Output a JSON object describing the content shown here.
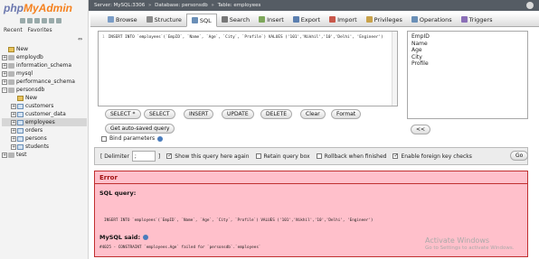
{
  "logo": {
    "part1": "php",
    "part2": "MyAdmin"
  },
  "nav": {
    "recent_label": "Recent",
    "favorites_label": "Favorites",
    "collapse_glyph": "⇔",
    "tree": [
      {
        "label": "New",
        "kind": "new",
        "level": 0
      },
      {
        "label": "employdb",
        "kind": "db",
        "level": 0
      },
      {
        "label": "information_schema",
        "kind": "db",
        "level": 0
      },
      {
        "label": "mysql",
        "kind": "db",
        "level": 0
      },
      {
        "label": "performance_schema",
        "kind": "db",
        "level": 0
      },
      {
        "label": "personsdb",
        "kind": "db",
        "level": 0,
        "expanded": true
      },
      {
        "label": "New",
        "kind": "new",
        "level": 1
      },
      {
        "label": "customers",
        "kind": "table",
        "level": 1
      },
      {
        "label": "customer_data",
        "kind": "table",
        "level": 1
      },
      {
        "label": "employees",
        "kind": "table",
        "level": 1,
        "selected": true
      },
      {
        "label": "orders",
        "kind": "table",
        "level": 1
      },
      {
        "label": "persons",
        "kind": "table",
        "level": 1
      },
      {
        "label": "students",
        "kind": "table",
        "level": 1
      },
      {
        "label": "test",
        "kind": "db",
        "level": 0
      }
    ]
  },
  "titlebar": {
    "server": "Server: MySQL:3306",
    "database": "Database: personsdb",
    "table": "Table: employees"
  },
  "tabs": [
    {
      "label": "Browse",
      "icon": "browse-icon",
      "color": "#7a9cc6"
    },
    {
      "label": "Structure",
      "icon": "structure-icon",
      "color": "#8a8a8a"
    },
    {
      "label": "SQL",
      "icon": "sql-icon",
      "color": "#6a8fb7",
      "active": true
    },
    {
      "label": "Search",
      "icon": "search-icon",
      "color": "#777"
    },
    {
      "label": "Insert",
      "icon": "insert-icon",
      "color": "#7da75a"
    },
    {
      "label": "Export",
      "icon": "export-icon",
      "color": "#5b7fb0"
    },
    {
      "label": "Import",
      "icon": "import-icon",
      "color": "#c9574a"
    },
    {
      "label": "Privileges",
      "icon": "privileges-icon",
      "color": "#c9a24a"
    },
    {
      "label": "Operations",
      "icon": "operations-icon",
      "color": "#6a8fb7"
    },
    {
      "label": "Triggers",
      "icon": "triggers-icon",
      "color": "#8b6fb7"
    }
  ],
  "sql": {
    "line_number": "1",
    "query": "INSERT INTO `employees`(`EmpID`, `Name`, `Age`, `City`, `Profile`) VALUES ('101','Nikhil','10','Delhi', 'Engineer')"
  },
  "columns": [
    "EmpID",
    "Name",
    "Age",
    "City",
    "Profile"
  ],
  "buttons": {
    "select_star": "SELECT *",
    "select": "SELECT",
    "insert": "INSERT",
    "update": "UPDATE",
    "delete": "DELETE",
    "clear": "Clear",
    "format": "Format",
    "auto_saved": "Get auto-saved query",
    "insert_col": "<<",
    "go": "Go"
  },
  "bind_params": {
    "label": "Bind parameters",
    "checked": false
  },
  "options": {
    "delimiter_label": "[ Delimiter",
    "delimiter_value": ";",
    "delimiter_close": "]",
    "show_again": {
      "label": "Show this query here again",
      "checked": true
    },
    "retain_box": {
      "label": "Retain query box",
      "checked": false
    },
    "rollback": {
      "label": "Rollback when finished",
      "checked": false
    },
    "foreign_keys": {
      "label": "Enable foreign key checks",
      "checked": true
    }
  },
  "error": {
    "title": "Error",
    "sql_query_label": "SQL query:",
    "sql_query": "INSERT INTO `employees`(`EmpID`, `Name`, `Age`, `City`, `Profile`) VALUES ('101','Nikhil','10','Delhi', 'Engineer')",
    "mysql_said_label": "MySQL said:",
    "message": "#4025 - CONSTRAINT `employees.Age` failed for `personsdb`.`employees`"
  },
  "watermark": {
    "title": "Activate Windows",
    "subtitle": "Go to Settings to activate Windows."
  }
}
